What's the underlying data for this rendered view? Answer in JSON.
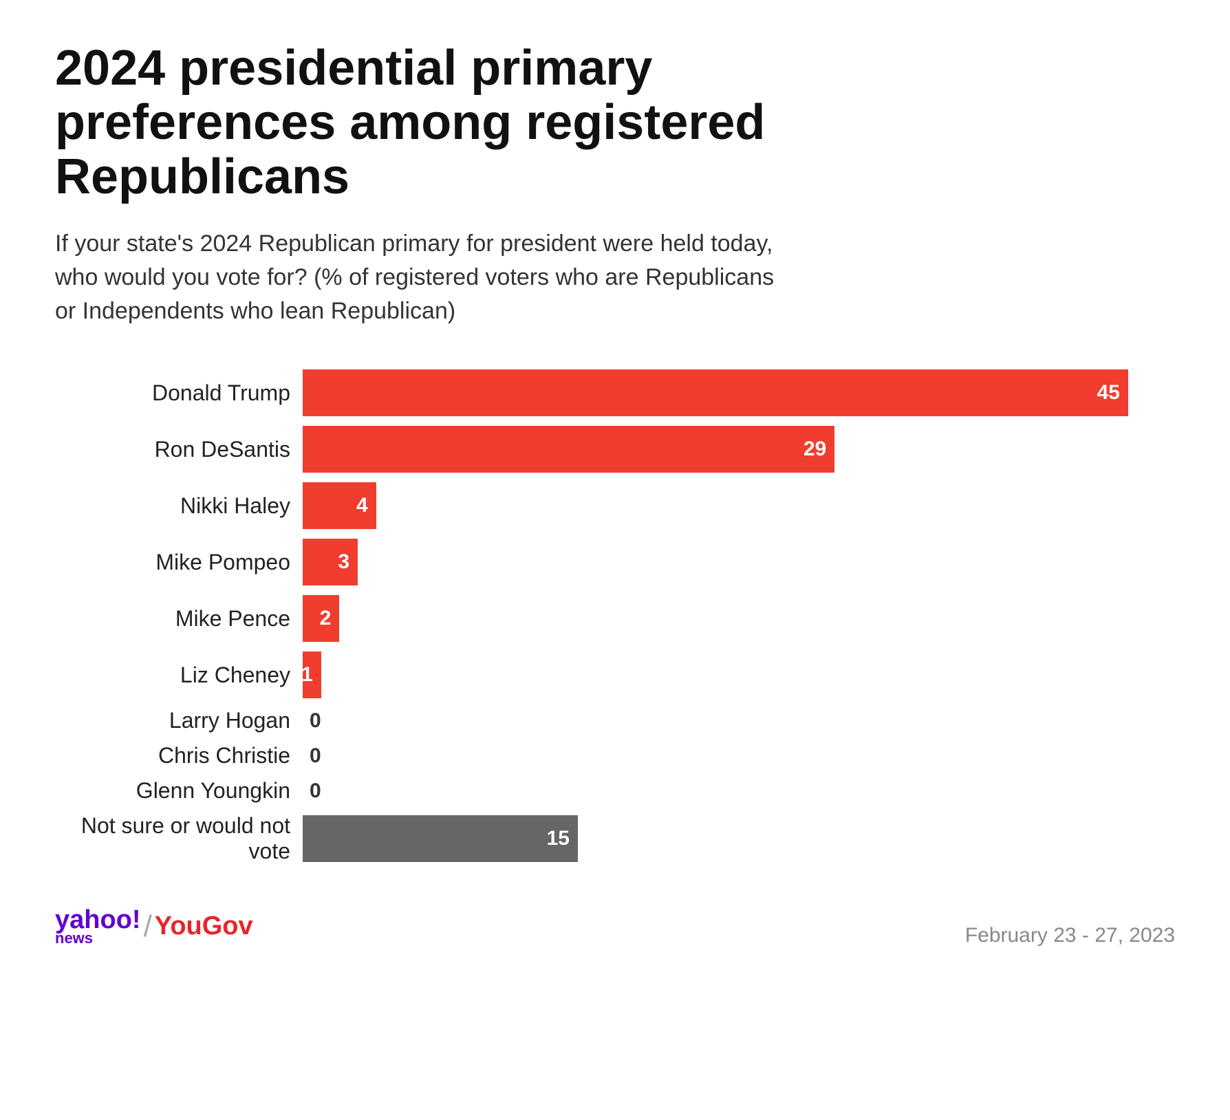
{
  "title": "2024 presidential primary preferences among registered Republicans",
  "subtitle": "If your state's 2024 Republican primary for president were held today, who would you vote for? (% of registered voters who are Republicans or Independents who lean Republican)",
  "chart": {
    "max_value": 45,
    "max_bar_width": 1200,
    "candidates": [
      {
        "name": "Donald Trump",
        "value": 45,
        "type": "red"
      },
      {
        "name": "Ron DeSantis",
        "value": 29,
        "type": "red"
      },
      {
        "name": "Nikki Haley",
        "value": 4,
        "type": "red"
      },
      {
        "name": "Mike Pompeo",
        "value": 3,
        "type": "red"
      },
      {
        "name": "Mike Pence",
        "value": 2,
        "type": "red"
      },
      {
        "name": "Liz Cheney",
        "value": 1,
        "type": "red"
      },
      {
        "name": "Larry Hogan",
        "value": 0,
        "type": "red"
      },
      {
        "name": "Chris Christie",
        "value": 0,
        "type": "red"
      },
      {
        "name": "Glenn Youngkin",
        "value": 0,
        "type": "red"
      },
      {
        "name": "Not sure or would not vote",
        "value": 15,
        "type": "gray"
      }
    ]
  },
  "footer": {
    "yahoo_label": "yahoo!",
    "news_label": "news",
    "slash": "/",
    "yougov_label": "YouGov",
    "date": "February 23 - 27, 2023"
  }
}
